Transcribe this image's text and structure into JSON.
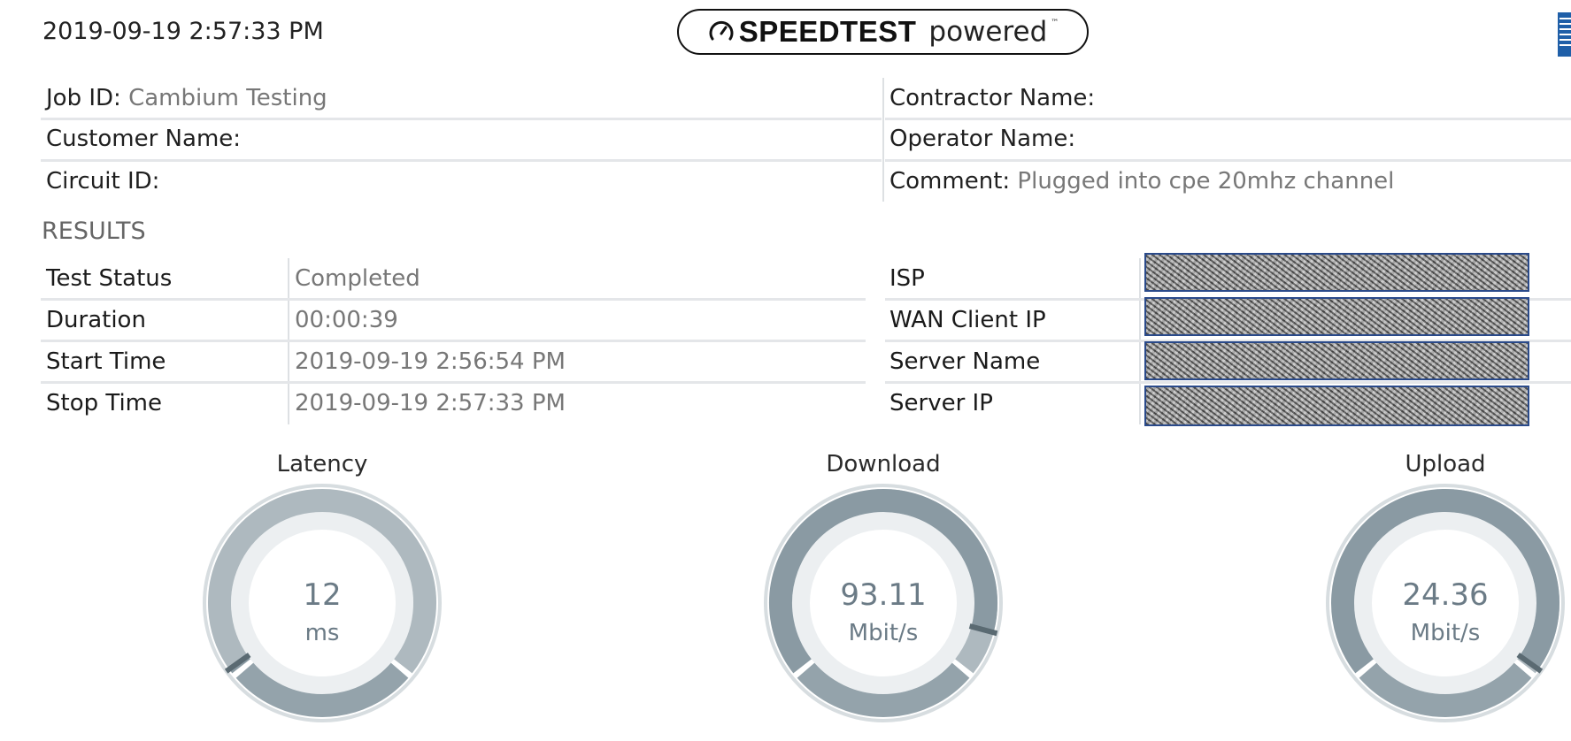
{
  "header": {
    "timestamp": "2019-09-19 2:57:33 PM",
    "logo_strong": "SPEEDTEST",
    "logo_light": "powered",
    "logo_tm": "™"
  },
  "job_info": {
    "left": [
      {
        "label": "Job ID:",
        "value": "Cambium Testing"
      },
      {
        "label": "Customer Name:",
        "value": ""
      },
      {
        "label": "Circuit ID:",
        "value": ""
      }
    ],
    "right": [
      {
        "label": "Contractor Name:",
        "value": ""
      },
      {
        "label": "Operator Name:",
        "value": ""
      },
      {
        "label": "Comment:",
        "value": "Plugged into cpe 20mhz channel"
      }
    ]
  },
  "results": {
    "title": "RESULTS",
    "left": [
      {
        "label": "Test Status",
        "value": "Completed"
      },
      {
        "label": "Duration",
        "value": "00:00:39"
      },
      {
        "label": "Start Time",
        "value": "2019-09-19 2:56:54 PM"
      },
      {
        "label": "Stop Time",
        "value": "2019-09-19 2:57:33 PM"
      }
    ],
    "right": [
      {
        "label": "ISP"
      },
      {
        "label": "WAN Client IP"
      },
      {
        "label": "Server Name"
      },
      {
        "label": "Server IP"
      }
    ]
  },
  "gauges": [
    {
      "title": "Latency",
      "value": "12",
      "unit": "ms",
      "needle_fraction": 0.01
    },
    {
      "title": "Download",
      "value": "93.11",
      "unit": "Mbit/s",
      "needle_fraction": 0.91
    },
    {
      "title": "Upload",
      "value": "24.36",
      "unit": "Mbit/s",
      "needle_fraction": 0.99
    }
  ],
  "colors": {
    "ring_light": "#aeb9bf",
    "ring_dark": "#8a9aa3",
    "ring_bottom": "#94a3ab",
    "ring_inner": "#eceff1",
    "needle": "#5a6a72",
    "value_text": "#6b7b86",
    "redaction_border": "#2a4a8a"
  }
}
